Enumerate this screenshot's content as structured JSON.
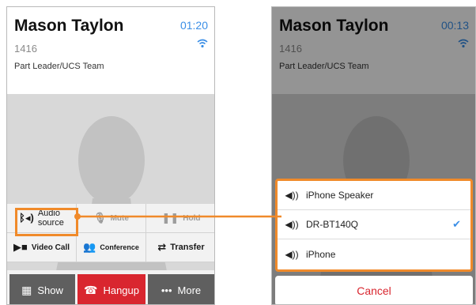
{
  "left_screen": {
    "contact": {
      "name": "Mason Taylon",
      "extension": "1416",
      "role": "Part Leader/UCS Team"
    },
    "status": {
      "time": "01:20",
      "wifi_icon": "wifi-icon"
    },
    "controls": {
      "audio_source_line1": "Audio",
      "audio_source_line2": "source",
      "mute": "Mute",
      "hold": "Hold",
      "video_call": "Video Call",
      "conference": "Conference",
      "transfer": "Transfer"
    },
    "bottom_bar": {
      "show": "Show",
      "hangup": "Hangup",
      "more": "More"
    }
  },
  "right_screen": {
    "contact": {
      "name": "Mason Taylon",
      "extension": "1416",
      "role": "Part Leader/UCS Team"
    },
    "status": {
      "time": "00:13"
    },
    "audio_sources": [
      {
        "label": "iPhone Speaker",
        "selected": false
      },
      {
        "label": "DR-BT140Q",
        "selected": true
      },
      {
        "label": "iPhone",
        "selected": false
      }
    ],
    "cancel": "Cancel"
  },
  "colors": {
    "accent": "#f08a2a",
    "hangup": "#d9262f",
    "link": "#3a8ee6"
  }
}
